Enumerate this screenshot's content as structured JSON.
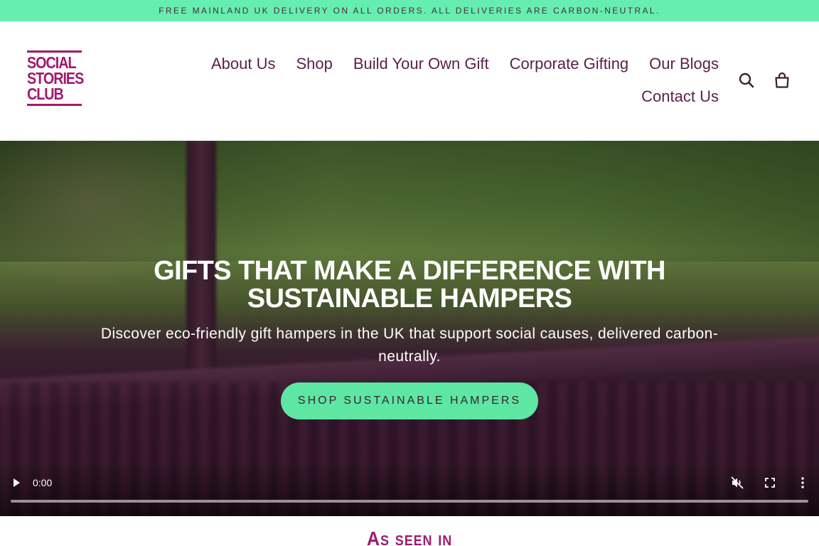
{
  "announcement": "FREE MAINLAND UK DELIVERY ON ALL ORDERS. ALL DELIVERIES ARE CARBON-NEUTRAL.",
  "logo": {
    "line1": "SOCIAL",
    "line2": "STORIES",
    "line3": "CLUB"
  },
  "nav": {
    "row1": [
      "About Us",
      "Shop",
      "Build Your Own Gift",
      "Corporate Gifting",
      "Our Blogs"
    ],
    "row2": [
      "Contact Us"
    ]
  },
  "icons": {
    "search": "search-icon",
    "cart": "cart-icon"
  },
  "hero": {
    "title": "GIFTS THAT MAKE A DIFFERENCE WITH SUSTAINABLE HAMPERS",
    "subtitle": "Discover eco-friendly gift hampers in the UK that support social causes, delivered carbon-neutrally.",
    "cta": "SHOP SUSTAINABLE HAMPERS"
  },
  "video": {
    "time": "0:00",
    "progress": 0
  },
  "as_seen_in": "As seen in",
  "colors": {
    "accent": "#66eeb0",
    "brand": "#a11a6e",
    "nav_text": "#5a1f4a"
  }
}
